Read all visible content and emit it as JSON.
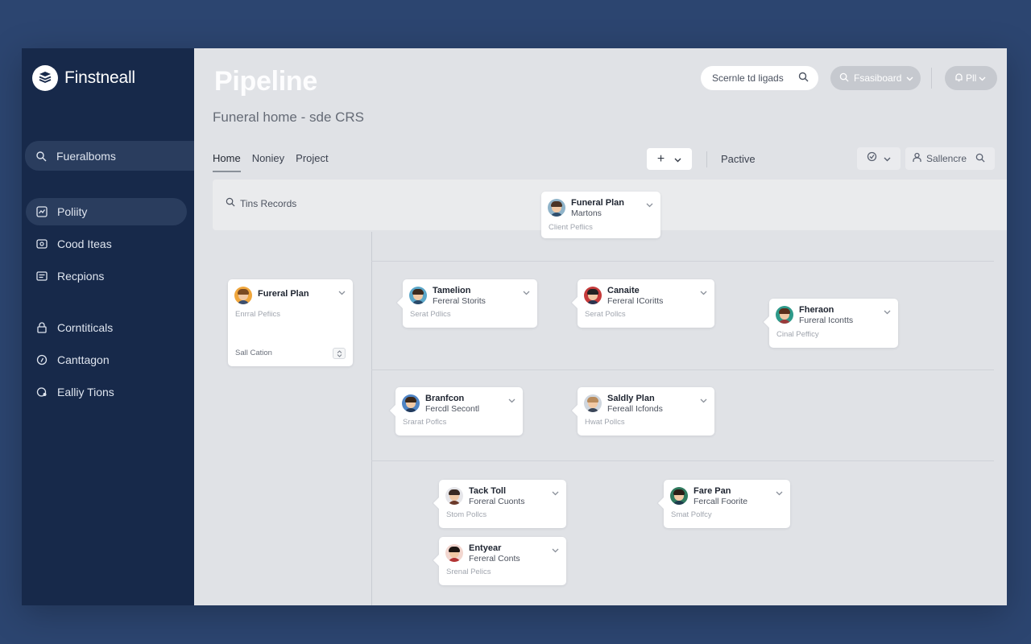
{
  "brand": {
    "name": "Finstneall"
  },
  "sidebar": {
    "items": [
      {
        "label": "Fueralboms",
        "icon": "pin-icon"
      },
      {
        "label": "Poliity",
        "icon": "chart-icon"
      },
      {
        "label": "Cood Iteas",
        "icon": "folder-icon"
      },
      {
        "label": "Recpions",
        "icon": "document-icon"
      },
      {
        "label": "Corntiticals",
        "icon": "lock-icon"
      },
      {
        "label": "Canttagon",
        "icon": "compass-icon"
      },
      {
        "label": "Ealliy Tions",
        "icon": "badge-icon"
      }
    ]
  },
  "header": {
    "title": "Pipeline",
    "subtitle": "Funeral home - sde CRS",
    "search_label": "Scernle td ligads",
    "dashboard_label": "Fsasiboard",
    "user_label": "Pll"
  },
  "toolbar": {
    "tabs": [
      "Home",
      "Noniey",
      "Project"
    ],
    "add_label": "+",
    "view_label": "Pactive",
    "sales_label": "Sallencre"
  },
  "records_band": {
    "label": "Tins Records"
  },
  "cards": [
    {
      "name": "Funeral Plan",
      "sub": "Martons",
      "foot": "Client Peflics"
    },
    {
      "name": "Fureral Plan",
      "sub": "",
      "foot": "Enrral Pefiics",
      "extra": "Sall Cation"
    },
    {
      "name": "Tamelion",
      "sub": "Fereral Storits",
      "foot": "Serat Pdlics"
    },
    {
      "name": "Canaite",
      "sub": "Fereral ICoritts",
      "foot": "Serat Pollcs"
    },
    {
      "name": "Fheraon",
      "sub": "Fureral Icontts",
      "foot": "Cinal Pefficy"
    },
    {
      "name": "Branfcon",
      "sub": "Fercdl Secontl",
      "foot": "Srarat Poflcs"
    },
    {
      "name": "Saldly Plan",
      "sub": "Fereall Icfonds",
      "foot": "Hwat Pollcs"
    },
    {
      "name": "Tack Toll",
      "sub": "Foreral Cuonts",
      "foot": "Stom Pollcs"
    },
    {
      "name": "Fare Pan",
      "sub": "Fercall Foorite",
      "foot": "Smat Polfcy"
    },
    {
      "name": "Entyear",
      "sub": "Fereral Conts",
      "foot": "Srenal Pelics"
    }
  ],
  "colors": {
    "background": "#2c4570",
    "sidebar": "#17294a",
    "main": "#e0e2e6",
    "card": "#ffffff"
  }
}
